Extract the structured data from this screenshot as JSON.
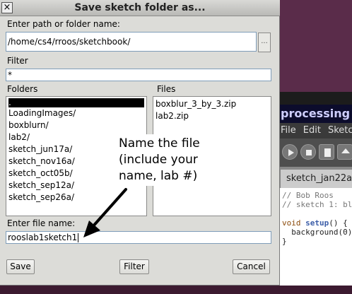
{
  "dialog": {
    "title": "Save sketch folder as...",
    "close_label": "×",
    "path_label": "Enter path or folder name:",
    "path_value": "/home/cs4/rroos/sketchbook/",
    "path_button_label": "...",
    "filter_label": "Filter",
    "filter_value": "*",
    "folders_label": "Folders",
    "files_label": "Files",
    "folders": [
      ".",
      "LoadingImages/",
      "boxblurn/",
      "lab2/",
      "sketch_jun17a/",
      "sketch_nov16a/",
      "sketch_oct05b/",
      "sketch_sep12a/",
      "sketch_sep26a/"
    ],
    "files": [
      "boxblur_3_by_3.zip",
      "lab2.zip"
    ],
    "filename_label": "Enter file name:",
    "filename_value": "rooslab1sketch1",
    "save_label": "Save",
    "filter_button_label": "Filter",
    "cancel_label": "Cancel"
  },
  "annotation": {
    "line1": "Name the file",
    "line2": "(include your",
    "line3": "name, lab #)"
  },
  "ide": {
    "banner": "processing",
    "menu": [
      "File",
      "Edit",
      "Sketch"
    ],
    "tab": "sketch_jan22a",
    "code_line1": "// Bob Roos",
    "code_line2": "// sketch 1: bl",
    "code_line3_kw": "void",
    "code_line3_fn": "setup",
    "code_line3_rest": "() {",
    "code_line4": "  background(0)",
    "code_line5": "}"
  }
}
